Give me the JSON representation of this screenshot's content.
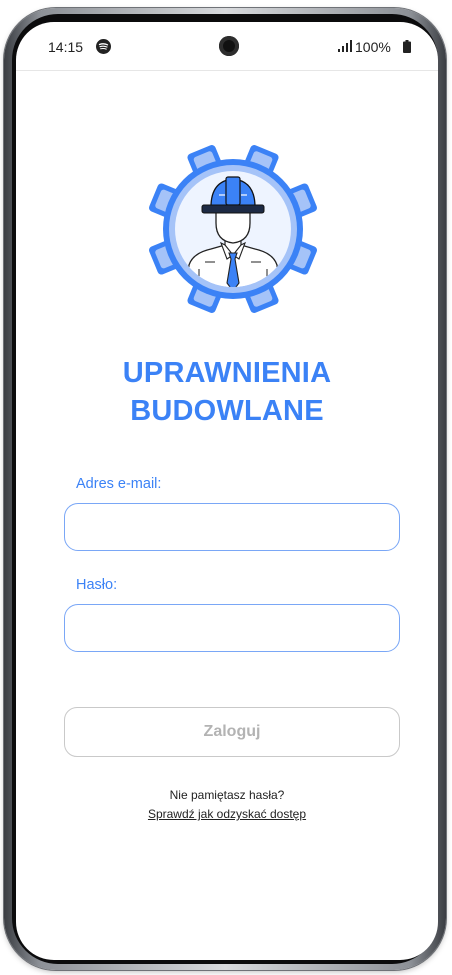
{
  "status_bar": {
    "time": "14:15",
    "battery_text": "100%",
    "icons": [
      "spotify-icon",
      "front-camera",
      "signal-icon",
      "battery-icon"
    ]
  },
  "app": {
    "title_line1": "UPRAWNIENIA",
    "title_line2": "BUDOWLANE",
    "logo_icon": "engineer-gear-logo",
    "accent_color": "#3b82f6"
  },
  "form": {
    "email_label": "Adres e-mail:",
    "email_value": "",
    "password_label": "Hasło:",
    "password_value": "",
    "login_button": "Zaloguj"
  },
  "footer": {
    "forgot_text": "Nie pamiętasz hasła?",
    "recover_link": "Sprawdź jak odzyskać dostęp"
  }
}
